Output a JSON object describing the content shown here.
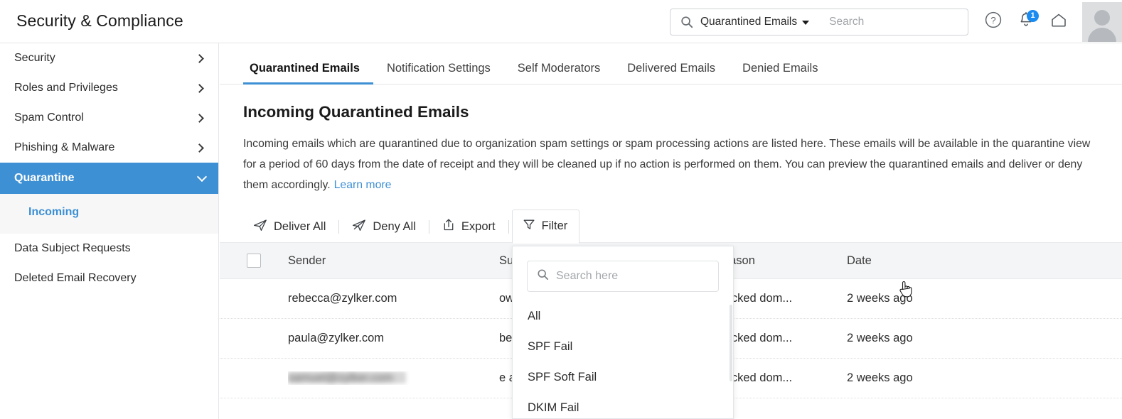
{
  "header": {
    "app_title": "Security & Compliance",
    "search": {
      "scope_label": "Quarantined Emails",
      "placeholder": "Search",
      "icon": "search-icon",
      "caret_icon": "chevron-down-icon"
    },
    "help_icon": "help-circle-icon",
    "notifications": {
      "icon": "bell-icon",
      "badge_count": "1"
    },
    "home_icon": "home-icon",
    "avatar": "user-avatar"
  },
  "sidebar": {
    "items": [
      {
        "label": "Security",
        "expandable": true,
        "state": "collapsed"
      },
      {
        "label": "Roles and Privileges",
        "expandable": true,
        "state": "collapsed"
      },
      {
        "label": "Spam Control",
        "expandable": true,
        "state": "collapsed"
      },
      {
        "label": "Phishing & Malware",
        "expandable": true,
        "state": "collapsed"
      },
      {
        "label": "Quarantine",
        "expandable": true,
        "state": "expanded",
        "active": true
      },
      {
        "label": "Data Subject Requests",
        "expandable": false
      },
      {
        "label": "Deleted Email Recovery",
        "expandable": false
      }
    ],
    "sub_items": [
      {
        "label": "Incoming",
        "selected": true
      }
    ]
  },
  "tabs": [
    {
      "label": "Quarantined Emails",
      "selected": true
    },
    {
      "label": "Notification Settings",
      "selected": false
    },
    {
      "label": "Self Moderators",
      "selected": false
    },
    {
      "label": "Delivered Emails",
      "selected": false
    },
    {
      "label": "Denied Emails",
      "selected": false
    }
  ],
  "page": {
    "title": "Incoming Quarantined Emails",
    "description": "Incoming emails which are quarantined due to organization spam settings or spam processing actions are listed here. These emails will be available in the quarantine view for a period of 60 days from the date of receipt and they will be cleaned up if no action is performed on them. You can preview the quarantined emails and deliver or deny them accordingly.",
    "learn_more": "Learn more"
  },
  "toolbar": {
    "deliver_all": "Deliver All",
    "deny_all": "Deny All",
    "export": "Export",
    "filter": "Filter",
    "icons": {
      "deliver": "paper-plane-icon",
      "deny": "paper-plane-slash-icon",
      "export": "upload-icon",
      "filter": "funnel-icon"
    }
  },
  "filter_panel": {
    "search_placeholder": "Search here",
    "search_icon": "search-icon",
    "options": [
      "All",
      "SPF Fail",
      "SPF Soft Fail",
      "DKIM Fail"
    ]
  },
  "table": {
    "columns": [
      "",
      "Sender",
      "Subject",
      "Reason",
      "Date"
    ],
    "rows": [
      {
        "sender": "rebecca@zylker.com",
        "subject": "ow your email opt-in r...",
        "reason": "Blocked dom...",
        "date": "2 weeks ago",
        "sender_redacted": false
      },
      {
        "sender": "paula@zylker.com",
        "subject": "better way to capture ...",
        "reason": "Blocked dom...",
        "date": "2 weeks ago",
        "sender_redacted": false
      },
      {
        "sender": "samuel@zylker.com",
        "subject": "e art of headline writi...",
        "reason": "Blocked dom...",
        "date": "2 weeks ago",
        "sender_redacted": true
      }
    ]
  },
  "colors": {
    "accent": "#3e90d4",
    "badge": "#1a8cf0",
    "link": "#3e90d4",
    "header_bg": "#f4f5f7",
    "text": "#2b2b2b"
  }
}
